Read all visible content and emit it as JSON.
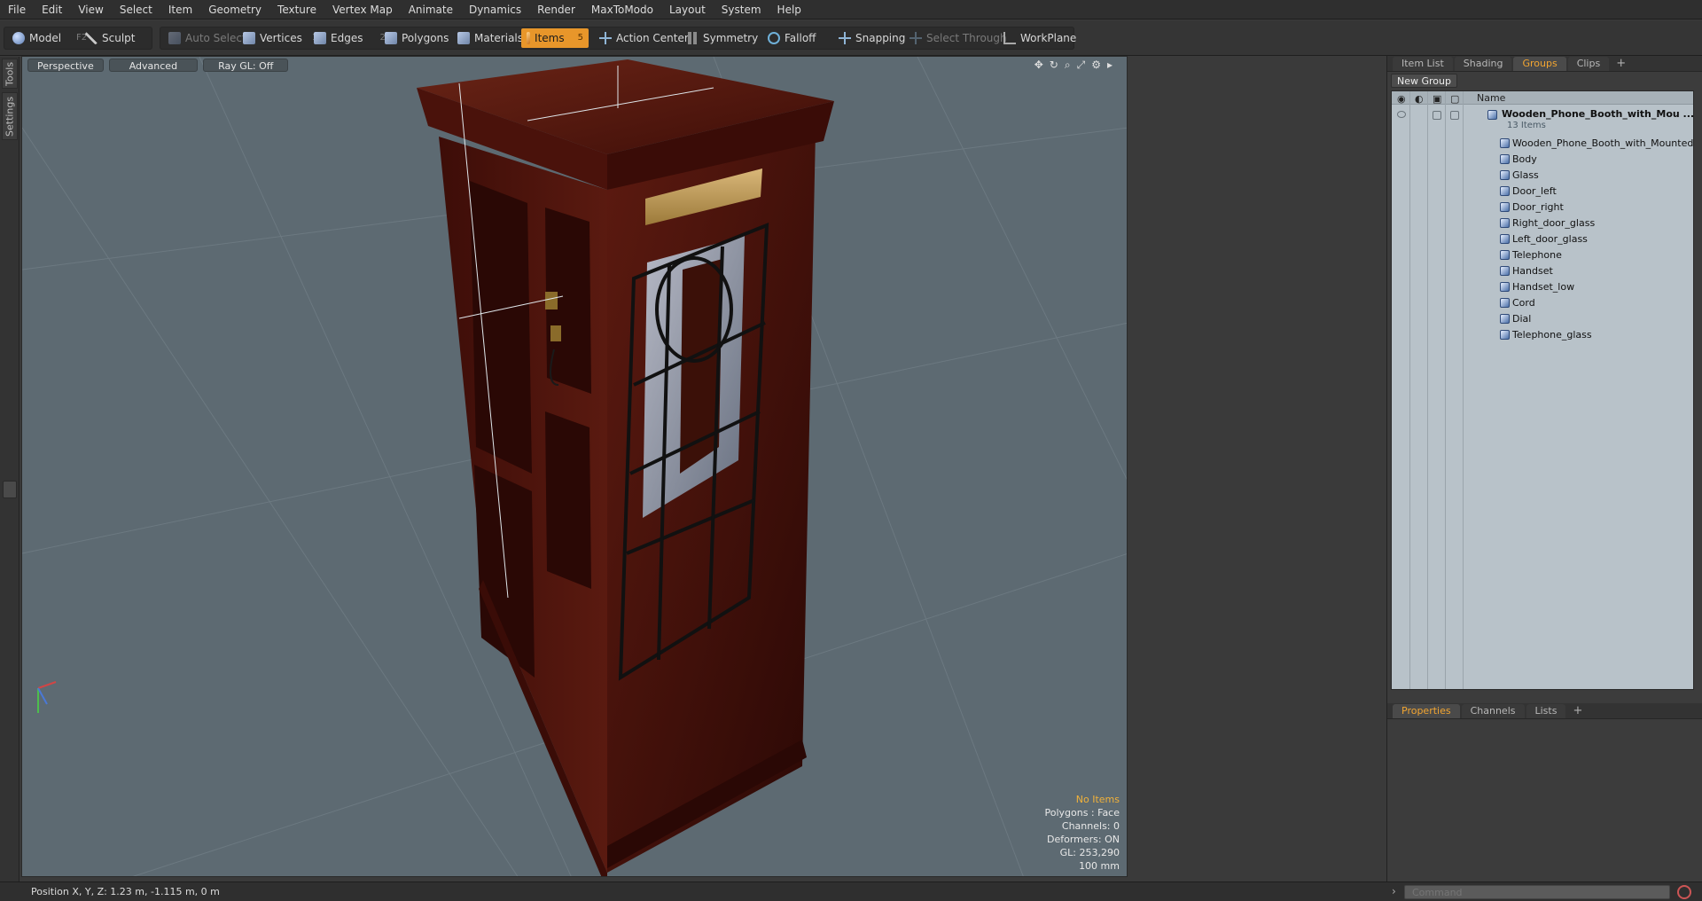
{
  "menu": [
    "File",
    "Edit",
    "View",
    "Select",
    "Item",
    "Geometry",
    "Texture",
    "Vertex Map",
    "Animate",
    "Dynamics",
    "Render",
    "MaxToModo",
    "Layout",
    "System",
    "Help"
  ],
  "toolbar": {
    "model": "Model",
    "model_key": "F2",
    "sculpt": "Sculpt",
    "auto_select": "Auto Select",
    "vertices": "Vertices",
    "vertices_key": "1",
    "edges": "Edges",
    "edges_key": "2",
    "polygons": "Polygons",
    "materials": "Materials",
    "items": "Items",
    "items_key": "5",
    "action_center": "Action Center",
    "symmetry": "Symmetry",
    "falloff": "Falloff",
    "snapping": "Snapping",
    "select_through": "Select Through",
    "workplane": "WorkPlane"
  },
  "left_tabs": {
    "tools": "Tools",
    "settings": "Settings"
  },
  "viewport": {
    "view": "Perspective",
    "shading": "Advanced",
    "raygl": "Ray GL: Off",
    "info": {
      "items": "No Items",
      "polygons": "Polygons : Face",
      "channels": "Channels: 0",
      "deformers": "Deformers: ON",
      "gl": "GL: 253,290",
      "scale": "100 mm"
    }
  },
  "panel": {
    "tabs": [
      "Item List",
      "Shading",
      "Groups",
      "Clips"
    ],
    "active_tab": "Groups",
    "new_group": "New Group",
    "name_col": "Name",
    "group": {
      "name": "Wooden_Phone_Booth_with_Mou ...",
      "count": "13 Items"
    },
    "items": [
      "Wooden_Phone_Booth_with_Mounted...",
      "Body",
      "Glass",
      "Door_left",
      "Door_right",
      "Right_door_glass",
      "Left_door_glass",
      "Telephone",
      "Handset",
      "Handset_low",
      "Cord",
      "Dial",
      "Telephone_glass"
    ]
  },
  "bottom_tabs": [
    "Properties",
    "Channels",
    "Lists"
  ],
  "status": {
    "position": "Position X, Y, Z:   1.23 m, -1.115 m, 0 m"
  },
  "command": {
    "placeholder": "Command"
  },
  "colors": {
    "accent": "#e8962a",
    "viewport_bg": "#5d6a72",
    "wood": "#4a120c"
  }
}
